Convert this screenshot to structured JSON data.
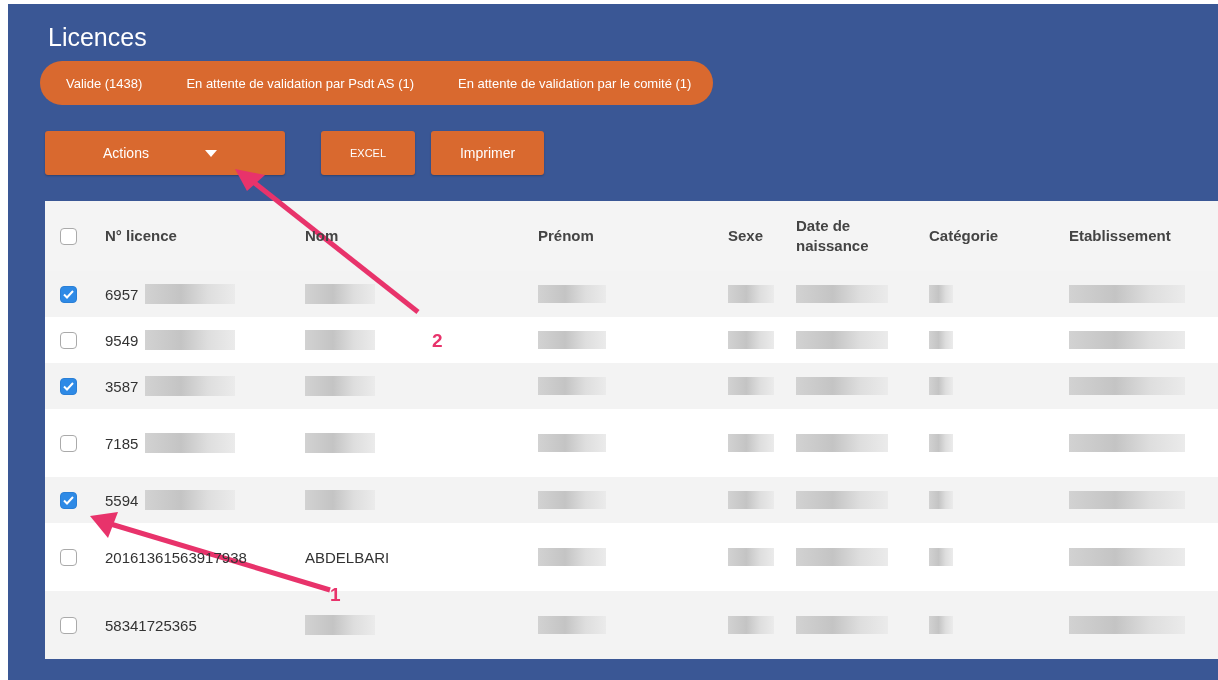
{
  "title": "Licences",
  "status_tabs": [
    "Valide (1438)",
    "En attente de validation par Psdt AS (1)",
    "En attente de validation par le comité (1)"
  ],
  "buttons": [
    {
      "kind": "dropdown",
      "label": "Actions"
    },
    {
      "kind": "small",
      "label": "EXCEL"
    },
    {
      "kind": "plain",
      "label": "Imprimer"
    }
  ],
  "table": {
    "select_all": {
      "checked": false
    },
    "columns": [
      "N° licence",
      "Nom",
      "Prénom",
      "Sexe",
      "Date de naissance",
      "Catégorie",
      "Etablissement"
    ],
    "rows": [
      {
        "checked": true,
        "licence": "6957"
      },
      {
        "checked": false,
        "licence": "9549"
      },
      {
        "checked": true,
        "licence": "3587"
      },
      {
        "checked": false,
        "licence": "7185"
      },
      {
        "checked": true,
        "licence": "5594"
      },
      {
        "checked": false,
        "licence": "20161361563917938",
        "nom": "ABDELBARI"
      },
      {
        "checked": false,
        "licence": "58341725365"
      }
    ]
  },
  "annotations": [
    {
      "label": "2"
    },
    {
      "label": "1"
    }
  ]
}
